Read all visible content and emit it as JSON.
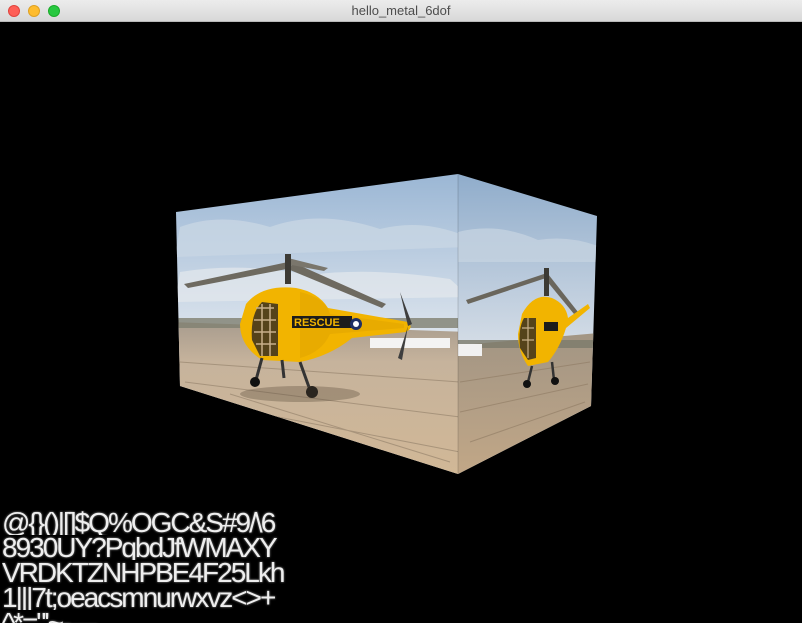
{
  "window": {
    "title": "hello_metal_6dof",
    "controls": [
      "close",
      "minimize",
      "zoom"
    ]
  },
  "scene": {
    "object": "textured-cube",
    "texture": "yellow-rescue-helicopter-photo",
    "faces_visible": [
      "front",
      "right"
    ]
  },
  "overlay_text": {
    "lines": [
      "@{}()|[]$Q%OGC&S#9/\\6",
      "8930UY?PqbdJfWMAXY",
      "VRDKTZNHPBE4F25Lkh",
      "1|||7t;oeacsmnurwxvz<>+",
      "^*=\"'~-—"
    ]
  },
  "colors": {
    "background": "#000000",
    "titlebar": "#e6e6e6",
    "helicopter_yellow": "#f2b400",
    "sky": "#a9c3dc",
    "tarmac": "#c9ad8d"
  }
}
